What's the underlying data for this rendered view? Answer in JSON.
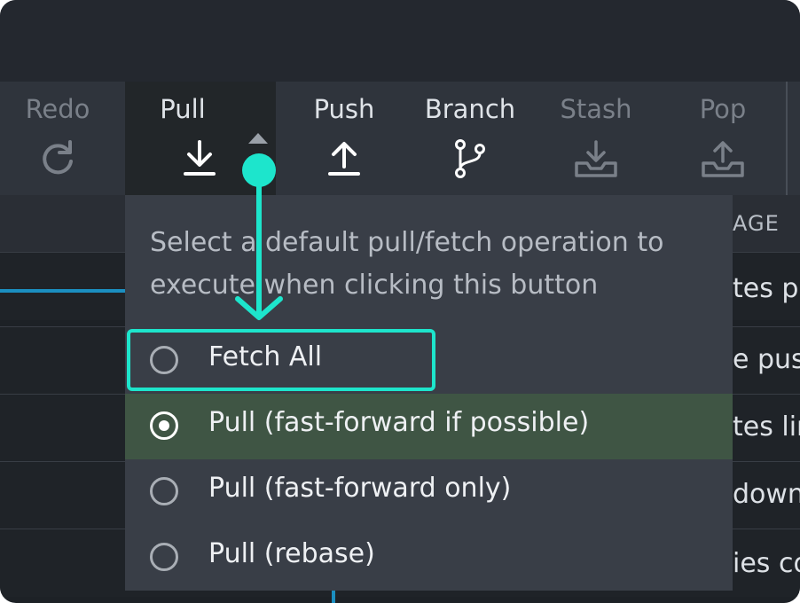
{
  "toolbar": {
    "buttons": [
      {
        "label": "Redo",
        "icon": "redo-icon",
        "state": "disabled"
      },
      {
        "label": "Pull",
        "icon": "pull-icon",
        "state": "active"
      },
      {
        "label": "Push",
        "icon": "push-icon",
        "state": "normal"
      },
      {
        "label": "Branch",
        "icon": "branch-icon",
        "state": "normal"
      },
      {
        "label": "Stash",
        "icon": "stash-icon",
        "state": "disabled"
      },
      {
        "label": "Pop",
        "icon": "pop-icon",
        "state": "disabled"
      }
    ]
  },
  "column_header": "AGE",
  "commit_rows": [
    "tes pu",
    "e pus",
    "tes lir",
    "down",
    "ies co"
  ],
  "pull_dropdown": {
    "description": "Select a default pull/fetch operation to execute when clicking this button",
    "options": [
      {
        "label": "Fetch All",
        "selected": false,
        "highlighted": true
      },
      {
        "label": "Pull (fast-forward if possible)",
        "selected": true,
        "highlighted": false
      },
      {
        "label": "Pull (fast-forward only)",
        "selected": false,
        "highlighted": false
      },
      {
        "label": "Pull (rebase)",
        "selected": false,
        "highlighted": false
      }
    ]
  },
  "colors": {
    "annotation": "#1de5cc",
    "selected_option_bg": "#3f5544",
    "dropdown_bg": "#393e47",
    "graph_line": "#1b8fc1"
  }
}
